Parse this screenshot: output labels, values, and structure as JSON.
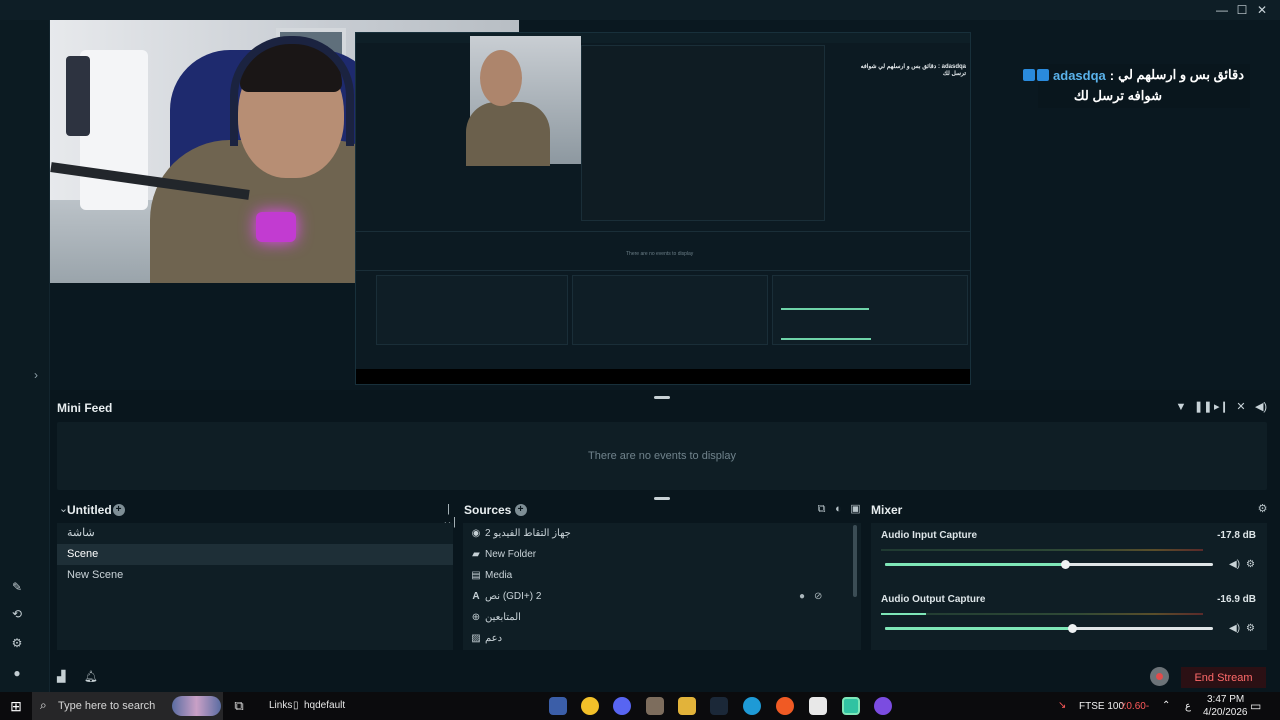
{
  "window": {
    "minimize": "—",
    "maximize": "☐",
    "close": "✕"
  },
  "preview": {
    "chat": {
      "username": "adasdqa",
      "line1": "دقائق بس و ارسلهم لي",
      "separator": ":",
      "line2": "شوافه ترسل لك"
    },
    "nested_chat": "adasdqa : دقائق بس و ارسلهم لي شوافه ترسل لك",
    "nested_no_events": "There are no events to display"
  },
  "minifeed": {
    "title": "Mini Feed",
    "empty_text": "There are no events to display"
  },
  "scenes": {
    "title": "Untitled",
    "items": [
      "شاشة",
      "Scene",
      "New Scene"
    ],
    "active": "Scene"
  },
  "sources": {
    "title": "Sources",
    "items": [
      {
        "label": "جهاز التقاط الفيديو 2",
        "icon": "camera-icon"
      },
      {
        "label": "New Folder",
        "icon": "folder-icon"
      },
      {
        "label": "Media",
        "icon": "media-icon"
      },
      {
        "label": "نص (GDI+) 2",
        "icon": "text-icon"
      },
      {
        "label": "المتابعين",
        "icon": "globe-icon"
      },
      {
        "label": "دعم",
        "icon": "image-icon"
      }
    ]
  },
  "mixer": {
    "title": "Mixer",
    "channels": [
      {
        "name": "Audio Input Capture",
        "db": "-17.8 dB",
        "level": 0.0,
        "volume": 0.55
      },
      {
        "name": "Audio Output Capture",
        "db": "-16.9 dB",
        "level": 0.14,
        "volume": 0.57
      }
    ]
  },
  "footer": {
    "end_stream": "End Stream"
  },
  "taskbar": {
    "search_placeholder": "Type here to search",
    "links": "Links",
    "file": "hqdefault",
    "ticker": "FTSE 100",
    "ticker_change": "-0.60%",
    "ticker_display": "٪0.60-",
    "lang": "ع",
    "time": "3:47 PM",
    "date": "4/20/2026"
  },
  "colors": {
    "accent": "#7ee6b7",
    "end_stream_text": "#ff6a6a",
    "chat_user": "#5ab2ea",
    "background": "#09161d"
  }
}
